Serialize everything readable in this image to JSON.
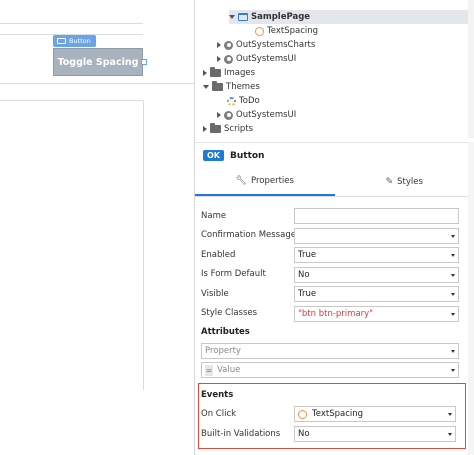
{
  "canvas": {
    "widget_tag": "Button",
    "button_label": "Toggle Spacing"
  },
  "tree": {
    "items": [
      {
        "label": "SamplePage",
        "icon": "page-icon",
        "expander": "expanded",
        "selected": true
      },
      {
        "label": "TextSpacing",
        "icon": "screen-icon",
        "expander": "none"
      },
      {
        "label": "OutSystemsCharts",
        "icon": "module-icon",
        "expander": "collapsed"
      },
      {
        "label": "OutSystemsUI",
        "icon": "module-icon",
        "expander": "collapsed"
      },
      {
        "label": "Images",
        "icon": "folder-icon",
        "expander": "collapsed"
      },
      {
        "label": "Themes",
        "icon": "folder-icon",
        "expander": "expanded"
      },
      {
        "label": "ToDo",
        "icon": "theme-icon",
        "expander": "none"
      },
      {
        "label": "OutSystemsUI",
        "icon": "module-icon",
        "expander": "collapsed"
      },
      {
        "label": "Scripts",
        "icon": "folder-icon",
        "expander": "collapsed"
      }
    ]
  },
  "properties": {
    "badge": "OK",
    "title": "Button",
    "tabs": [
      {
        "label": "Properties",
        "icon": "wrench-icon",
        "active": true
      },
      {
        "label": "Styles",
        "icon": "brush-icon",
        "active": false
      }
    ],
    "rows": [
      {
        "label": "Name",
        "value": "",
        "dropdown": false
      },
      {
        "label": "Confirmation Message",
        "value": "",
        "dropdown": true
      },
      {
        "label": "Enabled",
        "value": "True",
        "dropdown": true
      },
      {
        "label": "Is Form Default",
        "value": "No",
        "dropdown": true
      },
      {
        "label": "Visible",
        "value": "True",
        "dropdown": true
      },
      {
        "label": "Style Classes",
        "value": "\"btn btn-primary\"",
        "dropdown": true
      }
    ],
    "attributes": {
      "title": "Attributes",
      "property_placeholder": "Property",
      "value_placeholder": "Value",
      "eq": "="
    },
    "events": {
      "title": "Events",
      "rows": [
        {
          "label": "On Click",
          "value": "TextSpacing",
          "icon": "screen-icon"
        },
        {
          "label": "Built-in Validations",
          "value": "No"
        }
      ]
    }
  },
  "colors": {
    "accent": "#1f7ad6",
    "highlight": "#e04a3a"
  }
}
